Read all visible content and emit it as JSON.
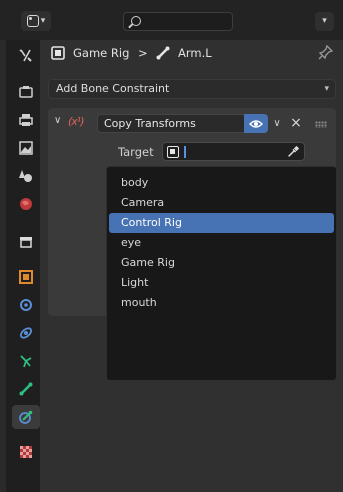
{
  "header": {
    "editor_type_icon": "properties-editor-icon",
    "search_icon": "search-icon",
    "search_placeholder": "",
    "menu_icon": "chevron-down-icon"
  },
  "tabs": [
    {
      "name": "tool",
      "icon": "wrench-screwdriver-icon"
    },
    {
      "name": "render",
      "icon": "camera-back-icon"
    },
    {
      "name": "output",
      "icon": "printer-icon"
    },
    {
      "name": "view-layer",
      "icon": "image-icon"
    },
    {
      "name": "scene",
      "icon": "cone-sphere-icon"
    },
    {
      "name": "world",
      "icon": "globe-icon"
    },
    {
      "name": "collection",
      "icon": "box-icon"
    },
    {
      "name": "object",
      "icon": "orange-square-icon"
    },
    {
      "name": "modifiers",
      "icon": "blue-circle-icon"
    },
    {
      "name": "physics",
      "icon": "orbit-icon"
    },
    {
      "name": "object-data",
      "icon": "armature-icon"
    },
    {
      "name": "bone",
      "icon": "bone-icon"
    },
    {
      "name": "bone-constraints",
      "icon": "bone-constraint-icon",
      "active": true
    },
    {
      "name": "texture",
      "icon": "checker-icon"
    }
  ],
  "breadcrumb": {
    "object": "Game Rig",
    "separator": ">",
    "bone": "Arm.L",
    "pin_icon": "pin-icon"
  },
  "constraints": {
    "add_label": "Add Bone Constraint",
    "panel": {
      "name": "Copy Transforms",
      "icon": "copy-transforms-icon",
      "target_label": "Target",
      "target_value": ""
    }
  },
  "dropdown": {
    "items": [
      "body",
      "Camera",
      "Control Rig",
      "eye",
      "Game Rig",
      "Light",
      "mouth"
    ],
    "selected": "Control Rig"
  },
  "colors": {
    "accent": "#4772b3",
    "bg": "#303030",
    "panel": "#3a3a3a",
    "menu_bg": "#181818"
  }
}
